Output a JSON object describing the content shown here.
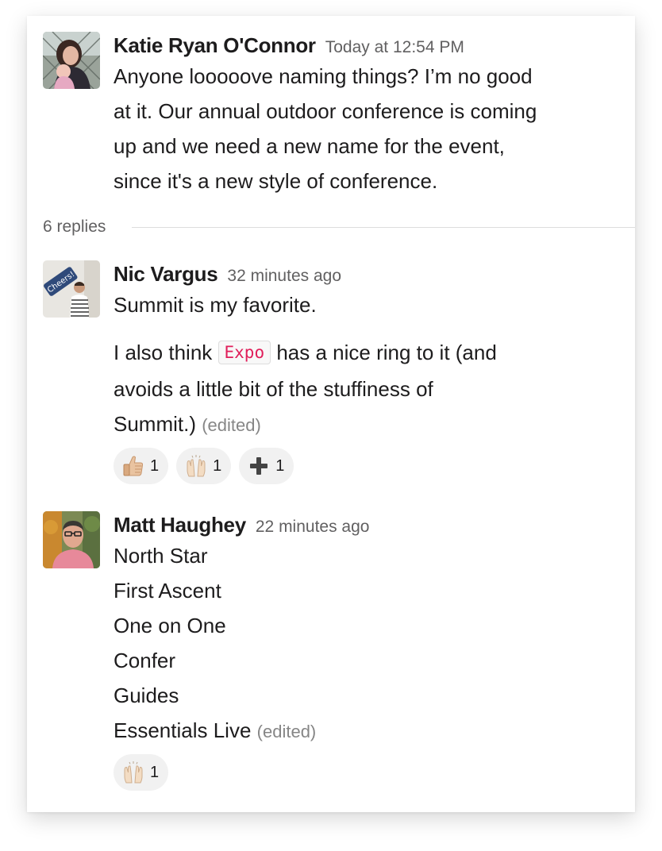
{
  "thread": {
    "parent": {
      "author": "Katie Ryan O'Connor",
      "timestamp": "Today at 12:54 PM",
      "lines": [
        "Anyone looooove naming things? I’m no good",
        "at it. Our annual outdoor conference is coming",
        "up and we need a new name for the event,",
        "since it's a new style of conference."
      ]
    },
    "replies_label": "6 replies",
    "replies": [
      {
        "author": "Nic Vargus",
        "timestamp": "32 minutes ago",
        "line1": "Summit is my favorite.",
        "line2_before": "I also think ",
        "code": "Expo",
        "line2_after": " has a nice ring to it (and",
        "line3": "avoids a little bit of the stuffiness of",
        "line4": "Summit.)",
        "edited": "(edited)",
        "reactions": [
          {
            "emoji": "thumbs-up-icon",
            "count": "1"
          },
          {
            "emoji": "raised-hands-icon",
            "count": "1"
          },
          {
            "emoji": "plus-icon",
            "count": "1"
          }
        ]
      },
      {
        "author": "Matt Haughey",
        "timestamp": "22 minutes ago",
        "lines": [
          "North Star",
          "First Ascent",
          "One on One",
          "Confer",
          "Guides"
        ],
        "last_line": "Essentials Live",
        "edited": "(edited)",
        "reactions": [
          {
            "emoji": "raised-hands-icon",
            "count": "1"
          }
        ]
      }
    ]
  }
}
